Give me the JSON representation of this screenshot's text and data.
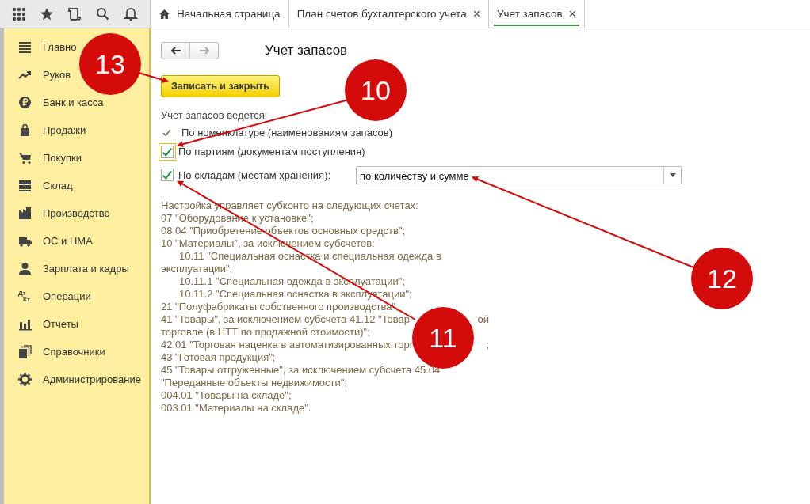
{
  "toolbar": {
    "tools": [
      {
        "kind": "apps"
      },
      {
        "kind": "star"
      },
      {
        "kind": "history"
      },
      {
        "kind": "search"
      },
      {
        "kind": "bell"
      }
    ]
  },
  "tabs": [
    {
      "label": "Начальная страница",
      "kind": "home",
      "selected": false,
      "closable": false
    },
    {
      "label": "План счетов бухгалтерского учета",
      "kind": "page",
      "selected": false,
      "closable": true
    },
    {
      "label": "Учет запасов",
      "kind": "page",
      "selected": true,
      "closable": true
    }
  ],
  "close_glyph": "×",
  "sidebar": {
    "items": [
      {
        "label": "Главно",
        "kind": "menu"
      },
      {
        "label": "Руков",
        "kind": "trend"
      },
      {
        "label": "Банк и касса",
        "kind": "coin"
      },
      {
        "label": "Продажи",
        "kind": "bag"
      },
      {
        "label": "Покупки",
        "kind": "cart"
      },
      {
        "label": "Склад",
        "kind": "boxes"
      },
      {
        "label": "Производство",
        "kind": "factory"
      },
      {
        "label": "ОС и НМА",
        "kind": "truck"
      },
      {
        "label": "Зарплата и кадры",
        "kind": "person"
      },
      {
        "label": "Операции",
        "kind": "dtkt"
      },
      {
        "label": "Отчеты",
        "kind": "chart"
      },
      {
        "label": "Справочники",
        "kind": "books"
      },
      {
        "label": "Администрирование",
        "kind": "gear"
      }
    ],
    "dt": "Дт",
    "kt": "Кт"
  },
  "form": {
    "title": "Учет запасов",
    "nav": {
      "back_enabled": true,
      "forward_enabled": false
    },
    "save_button": "Записать и закрыть",
    "intro": "Учет запасов ведется:",
    "options": [
      {
        "kind": "fixed",
        "label": "По номенклатуре (наименованиям запасов)",
        "checked": true
      },
      {
        "kind": "checkbox",
        "label": "По партиям (документам поступления)",
        "checked": true,
        "focused": true
      },
      {
        "kind": "checkbox",
        "label": "По складам (местам хранения):",
        "checked": true,
        "focused": false,
        "select": "по количеству и сумме"
      }
    ],
    "note": "Настройка управляет субконто на следующих счетах:",
    "accounts": [
      {
        "lines": [
          {
            "text": "07 \"Оборудование к установке\";"
          }
        ]
      },
      {
        "lines": [
          {
            "text": "08.04 \"Приобретение объектов основных средств\";"
          }
        ]
      },
      {
        "lines": [
          {
            "text": "10 \"Материалы\", за исключением субсчетов:"
          }
        ],
        "children": [
          {
            "lines": [
              {
                "text": "10.11 \"Специальная оснастка и специальная одежда в"
              },
              {
                "text": "эксплуатации\";"
              }
            ]
          },
          {
            "lines": [
              {
                "text": "10.11.1 \"Специальная одежда в эксплуатации\";"
              }
            ]
          },
          {
            "lines": [
              {
                "text": "10.11.2 \"Специальная оснастка в эксплуатации\";"
              }
            ]
          }
        ]
      },
      {
        "lines": [
          {
            "text": "21 \"Полуфабрикаты собственного производства\";"
          }
        ]
      },
      {
        "lines": [
          {
            "text": "41 \"Товары\", за исключением субсчета 41.12 \"Товар",
            "tail": "ой"
          },
          {
            "text": "торговле (в НТТ по продажной стоимости)\";"
          }
        ]
      },
      {
        "lines": [
          {
            "text": "42.01 \"Торговая наценка в автоматизированных торг",
            "tail": ";"
          }
        ]
      },
      {
        "lines": [
          {
            "text": "43 \"Готовая продукция\";"
          }
        ]
      },
      {
        "lines": [
          {
            "text": "45 \"Товары отгруженные\", за исключением субсчета 45.04"
          },
          {
            "text": "\"Переданные объекты недвижимости\";"
          }
        ]
      },
      {
        "lines": [
          {
            "text": "004.01 \"Товары на складе\";"
          }
        ]
      },
      {
        "lines": [
          {
            "text": "003.01 \"Материалы на складе\"."
          }
        ]
      }
    ]
  },
  "callouts": [
    {
      "number": "13"
    },
    {
      "number": "10"
    },
    {
      "number": "11"
    },
    {
      "number": "12"
    }
  ]
}
